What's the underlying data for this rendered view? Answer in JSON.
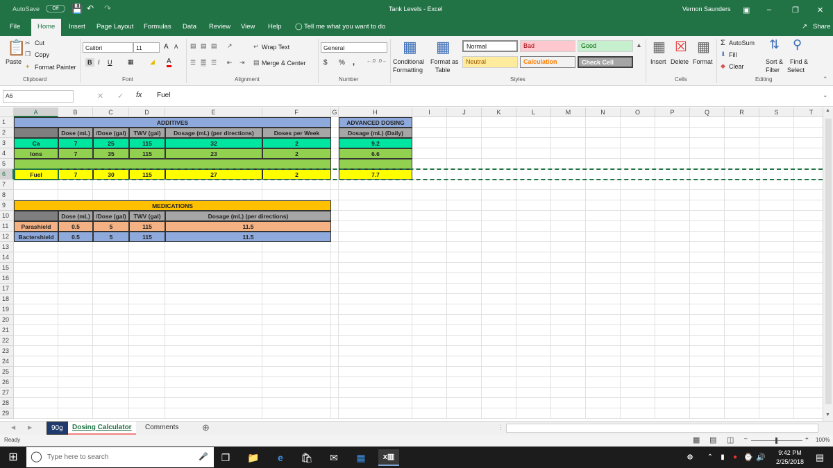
{
  "titlebar": {
    "autosave_label": "AutoSave",
    "autosave_state": "Off",
    "title": "Tank Levels  -  Excel",
    "user": "Vernon Saunders"
  },
  "tabs": [
    "File",
    "Home",
    "Insert",
    "Page Layout",
    "Formulas",
    "Data",
    "Review",
    "View",
    "Help"
  ],
  "tell_me": "Tell me what you want to do",
  "share": "Share",
  "ribbon": {
    "clipboard": {
      "paste": "Paste",
      "cut": "Cut",
      "copy": "Copy",
      "format_painter": "Format Painter",
      "label": "Clipboard"
    },
    "font": {
      "name": "Calibri",
      "size": "11",
      "label": "Font"
    },
    "alignment": {
      "wrap": "Wrap Text",
      "merge": "Merge & Center",
      "label": "Alignment"
    },
    "number": {
      "format": "General",
      "currency": "$",
      "percent": "%",
      "comma": ",",
      "label": "Number"
    },
    "styles": {
      "conditional": "Conditional",
      "formatting": "Formatting",
      "format_as": "Format as",
      "table": "Table",
      "normal": "Normal",
      "bad": "Bad",
      "good": "Good",
      "neutral": "Neutral",
      "calculation": "Calculation",
      "check_cell": "Check Cell",
      "label": "Styles"
    },
    "cells": {
      "insert": "Insert",
      "delete": "Delete",
      "format": "Format",
      "label": "Cells"
    },
    "editing": {
      "autosum": "AutoSum",
      "fill": "Fill",
      "clear": "Clear",
      "sort": "Sort &",
      "filter": "Filter",
      "find": "Find &",
      "select": "Select",
      "label": "Editing"
    }
  },
  "formula_bar": {
    "name_box": "A6",
    "fx": "fx",
    "content": "Fuel"
  },
  "columns": [
    "A",
    "B",
    "C",
    "D",
    "E",
    "F",
    "G",
    "H",
    "I",
    "J",
    "K",
    "L",
    "M",
    "N",
    "O",
    "P",
    "Q",
    "R",
    "S",
    "T"
  ],
  "rows": [
    "1",
    "2",
    "3",
    "4",
    "5",
    "6",
    "7",
    "8",
    "9",
    "10",
    "11",
    "12",
    "13",
    "14",
    "15",
    "16",
    "17",
    "18",
    "19",
    "20",
    "21",
    "22",
    "23",
    "24",
    "25",
    "26",
    "27",
    "28",
    "29"
  ],
  "additives": {
    "title": "ADDITIVES",
    "headers": [
      "Dose (mL)",
      "/Dose (gal)",
      "TWV (gal)",
      "Dosage (mL) (per directions)",
      "Doses per Week"
    ],
    "rows": [
      {
        "name": "Ca",
        "values": [
          "7",
          "25",
          "115",
          "32",
          "2"
        ]
      },
      {
        "name": "Ions",
        "values": [
          "7",
          "35",
          "115",
          "23",
          "2"
        ]
      },
      {
        "name": "Fuel",
        "values": [
          "7",
          "30",
          "115",
          "27",
          "2"
        ]
      }
    ]
  },
  "advanced": {
    "title": "ADVANCED DOSING",
    "header": "Dosage (mL) (Daily)",
    "values": [
      "9.2",
      "6.6",
      "7.7"
    ]
  },
  "medications": {
    "title": "MEDICATIONS",
    "headers": [
      "Dose (mL)",
      "/Dose (gal)",
      "TWV (gal)",
      "Dosage (mL) (per directions)"
    ],
    "rows": [
      {
        "name": "Parashield",
        "values": [
          "0.5",
          "5",
          "115",
          "11.5"
        ]
      },
      {
        "name": "Bactershield",
        "values": [
          "0.5",
          "5",
          "115",
          "11.5"
        ]
      }
    ]
  },
  "sheets": [
    "90g",
    "Dosing Calculator",
    "Comments"
  ],
  "status": {
    "ready": "Ready",
    "zoom": "100%"
  },
  "taskbar": {
    "search": "Type here to search",
    "time": "9:42 PM",
    "date": "2/25/2018"
  },
  "colors": {
    "excel_green": "#217346",
    "blue_header": "#8ea9db",
    "green_hl": "#00e5a0",
    "light_green": "#92d050",
    "yellow": "#ffff00",
    "orange": "#f4b183",
    "gold": "#ffc000",
    "med_blue": "#8ea9db",
    "gray_header": "#a6a6a6"
  }
}
